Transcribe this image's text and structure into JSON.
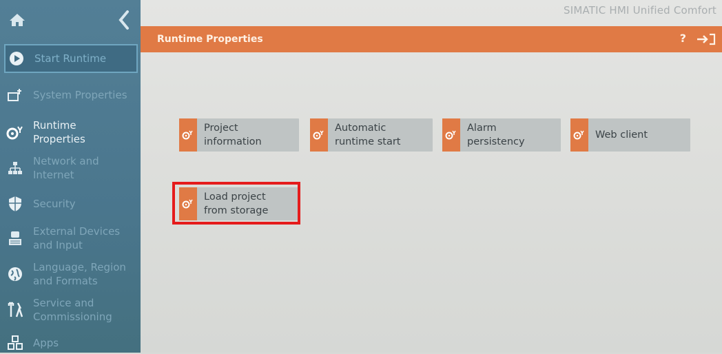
{
  "app": {
    "brand": "SIMATIC HMI Unified Comfort"
  },
  "sidebar": {
    "home_icon": "home-icon",
    "back_icon": "chevron-left-icon",
    "items": [
      {
        "label": "Start Runtime",
        "icon": "play-circle-icon"
      },
      {
        "label": "System Properties",
        "icon": "settings-icon"
      },
      {
        "label": "Runtime\nProperties",
        "icon": "runtime-icon"
      },
      {
        "label": "Network and\nInternet",
        "icon": "network-icon"
      },
      {
        "label": "Security",
        "icon": "shield-icon"
      },
      {
        "label": "External Devices\nand Input",
        "icon": "keyboard-icon"
      },
      {
        "label": "Language, Region\nand Formats",
        "icon": "globe-icon"
      },
      {
        "label": "Service and\nCommissioning",
        "icon": "tools-icon"
      },
      {
        "label": "Apps",
        "icon": "apps-icon"
      }
    ]
  },
  "header": {
    "title": "Runtime Properties",
    "help_label": "?",
    "exit_icon": "exit-icon"
  },
  "tiles": [
    {
      "label": "Project\ninformation"
    },
    {
      "label": "Automatic\nruntime start"
    },
    {
      "label": "Alarm\npersistency"
    },
    {
      "label": "Web client"
    },
    {
      "label": "Load project\nfrom storage"
    }
  ],
  "colors": {
    "accent": "#e07a45",
    "sidebar": "#4e7a91",
    "tile": "#bfc4c4",
    "highlight": "#e51b1b"
  }
}
